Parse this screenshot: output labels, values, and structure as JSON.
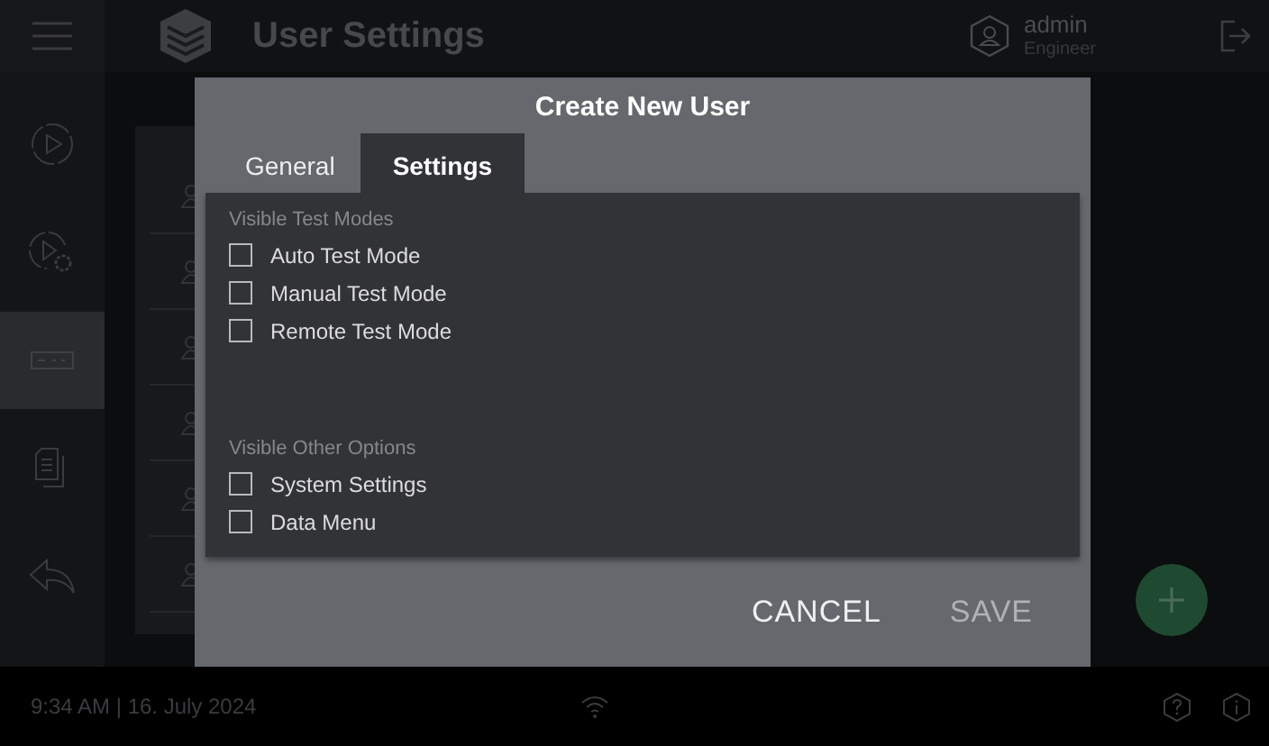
{
  "header": {
    "title": "User Settings",
    "user": {
      "name": "admin",
      "role": "Engineer"
    }
  },
  "sidebar": {
    "items": [
      {
        "kind": "play",
        "selected": false
      },
      {
        "kind": "play-settings",
        "selected": false
      },
      {
        "kind": "keyboard",
        "selected": true
      },
      {
        "kind": "documents",
        "selected": false
      },
      {
        "kind": "back",
        "selected": false
      }
    ]
  },
  "dialog": {
    "title": "Create New User",
    "tabs": [
      {
        "label": "General",
        "selected": false
      },
      {
        "label": "Settings",
        "selected": true
      }
    ],
    "sections": [
      {
        "heading": "Visible Test Modes",
        "options": [
          {
            "label": "Auto Test Mode",
            "checked": false
          },
          {
            "label": "Manual Test Mode",
            "checked": false
          },
          {
            "label": "Remote Test Mode",
            "checked": false
          }
        ]
      },
      {
        "heading": "Visible Other Options",
        "options": [
          {
            "label": "System Settings",
            "checked": false
          },
          {
            "label": "Data Menu",
            "checked": false
          }
        ]
      }
    ],
    "buttons": [
      {
        "label": "CANCEL",
        "disabled": false
      },
      {
        "label": "SAVE",
        "disabled": true
      }
    ]
  },
  "status_bar": {
    "datetime": "9:34 AM | 16. July 2024"
  }
}
